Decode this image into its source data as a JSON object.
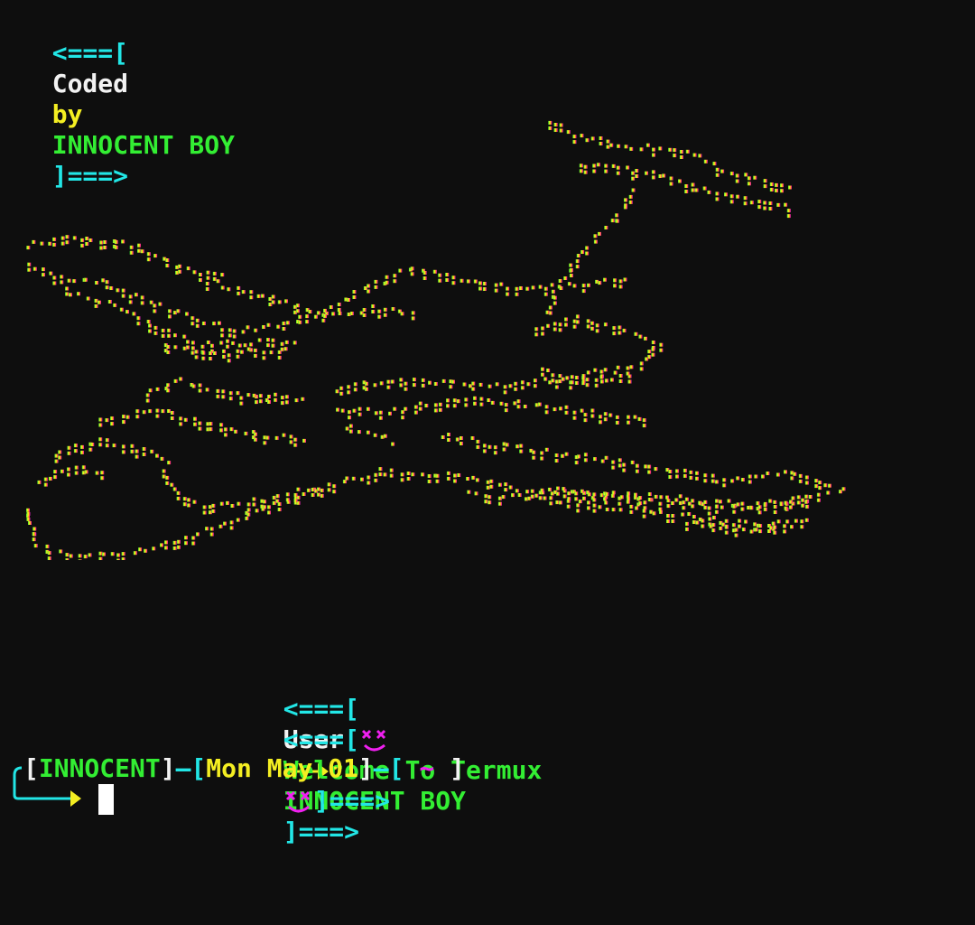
{
  "banner": {
    "open": "<===[",
    "coded": "Coded",
    "by": "by",
    "author": "INNOCENT BOY",
    "close": "]===>"
  },
  "art": {
    "description_icon": "braille-ascii-art-icon",
    "gradient_colors": [
      "#33ee33",
      "#f4ee22",
      "#ffb020",
      "#ff4040",
      "#f020f0"
    ]
  },
  "user_line": {
    "open": "<===[",
    "label": "User",
    "arrow_icon": "right-arrow-icon",
    "value": "INNOCENT BOY",
    "close": "]===>"
  },
  "welcome_line": {
    "open": "<===[",
    "left_icon": "xx-face-icon",
    "text": "Welcome To Termux",
    "right_icon": "xx-face-icon",
    "close": "]===>"
  },
  "prompt": {
    "lb1": "[",
    "name": "INNOCENT",
    "rb1": "]",
    "sep1": "—[",
    "date": "Mon May 01",
    "rb2": "]",
    "sep2": "—[",
    "dir": "~",
    "rb3": " ]"
  },
  "colors": {
    "background": "#0e0e0e",
    "cyan": "#22e6e6",
    "yellow": "#f4ee22",
    "green": "#33ee33",
    "magenta": "#f020f0",
    "white": "#f2f2f2"
  }
}
